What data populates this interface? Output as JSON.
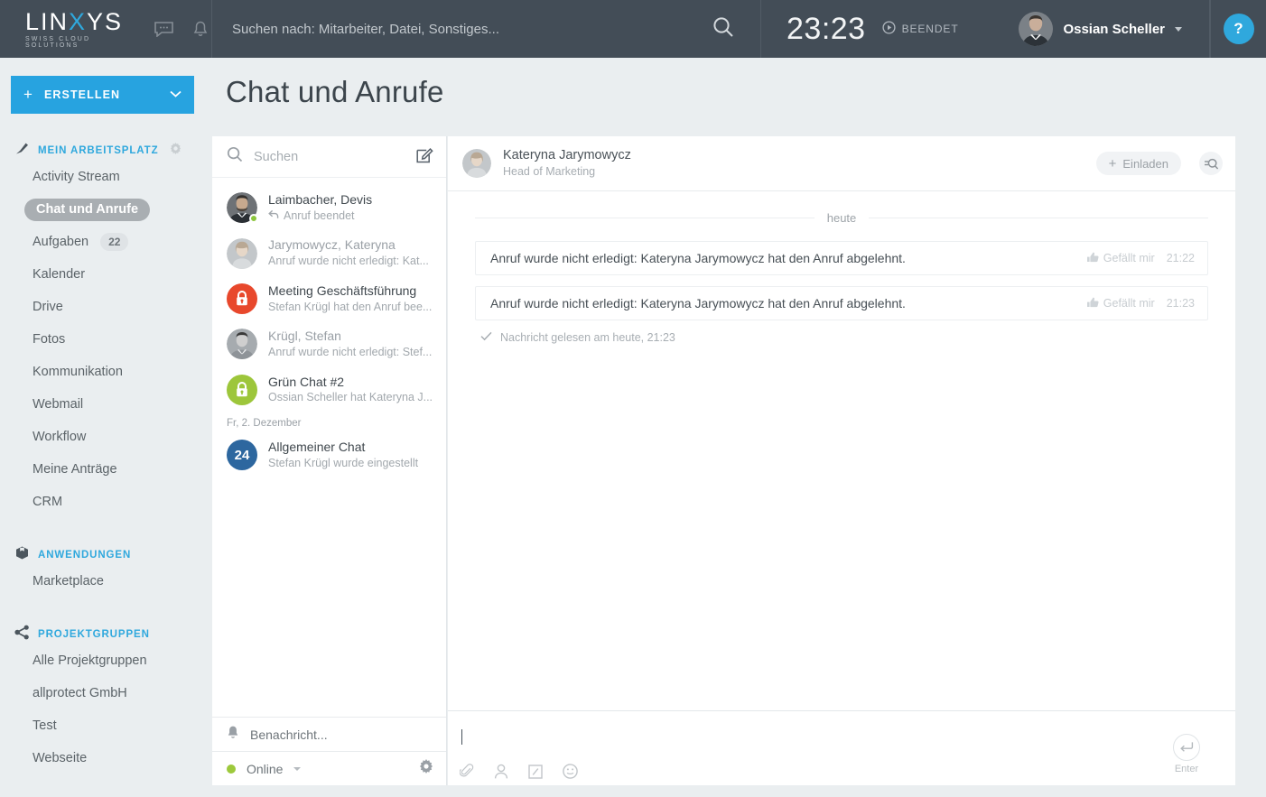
{
  "topbar": {
    "logo_main": "LIN",
    "logo_x": "X",
    "logo_main2": "YS",
    "logo_sub": "SWISS CLOUD SOLUTIONS",
    "chat_icon": "speech-bubble-icon",
    "bell_icon": "bell-icon",
    "search_placeholder": "Suchen nach: Mitarbeiter, Datei, Sonstiges...",
    "search_icon": "search-icon",
    "clock_time": "23:23",
    "clock_state": "BEENDET",
    "clock_state_icon": "play-circle-icon",
    "user_name": "Ossian Scheller",
    "user_caret": "chevron-down-icon",
    "help_label": "?"
  },
  "sidebar": {
    "create_label": "ERSTELLEN",
    "create_plus": "+",
    "sections": [
      {
        "title": "MEIN ARBEITSPLATZ",
        "icon": "pin-icon",
        "gear": true,
        "items": [
          {
            "label": "Activity Stream",
            "active": false,
            "badge": null
          },
          {
            "label": "Chat und Anrufe",
            "active": true,
            "badge": null
          },
          {
            "label": "Aufgaben",
            "active": false,
            "badge": "22"
          },
          {
            "label": "Kalender",
            "active": false,
            "badge": null
          },
          {
            "label": "Drive",
            "active": false,
            "badge": null
          },
          {
            "label": "Fotos",
            "active": false,
            "badge": null
          },
          {
            "label": "Kommunikation",
            "active": false,
            "badge": null
          },
          {
            "label": "Webmail",
            "active": false,
            "badge": null
          },
          {
            "label": "Workflow",
            "active": false,
            "badge": null
          },
          {
            "label": "Meine Anträge",
            "active": false,
            "badge": null
          },
          {
            "label": "CRM",
            "active": false,
            "badge": null
          }
        ]
      },
      {
        "title": "ANWENDUNGEN",
        "icon": "box-icon",
        "gear": false,
        "items": [
          {
            "label": "Marketplace",
            "active": false,
            "badge": null
          }
        ]
      },
      {
        "title": "PROJEKTGRUPPEN",
        "icon": "share-icon",
        "gear": false,
        "items": [
          {
            "label": "Alle Projektgruppen",
            "active": false,
            "badge": null
          },
          {
            "label": "allprotect GmbH",
            "active": false,
            "badge": null
          },
          {
            "label": "Test",
            "active": false,
            "badge": null
          },
          {
            "label": "Webseite",
            "active": false,
            "badge": null
          }
        ]
      }
    ]
  },
  "page": {
    "title": "Chat und Anrufe"
  },
  "chat_list": {
    "search_placeholder": "Suchen",
    "search_icon": "search-icon",
    "compose_icon": "compose-pencil-icon",
    "groups": [
      {
        "date_label": null,
        "rows": [
          {
            "name": "Laimbacher, Devis",
            "preview": "Anruf beendet",
            "preview_icon": "call-returned-arrow-icon",
            "avatar_type": "photo-male",
            "avatar_color": "#7b7f83",
            "online": true,
            "unread": true
          },
          {
            "name": "Jarymowycz, Kateryna",
            "preview": "Anruf wurde nicht erledigt: Kat...",
            "preview_icon": null,
            "avatar_type": "photo-female",
            "avatar_color": "#b7bcc0",
            "online": false,
            "unread": false
          },
          {
            "name": "Meeting Geschäftsführung",
            "preview": "Stefan Krügl hat den Anruf bee...",
            "preview_icon": null,
            "avatar_type": "lock",
            "avatar_color": "#e8482c",
            "online": false,
            "unread": true
          },
          {
            "name": "Krügl, Stefan",
            "preview": "Anruf wurde nicht erledigt: Stef...",
            "preview_icon": null,
            "avatar_type": "photo-male2",
            "avatar_color": "#9aa0a4",
            "online": false,
            "unread": false
          },
          {
            "name": "Grün Chat #2",
            "preview": "Ossian Scheller hat Kateryna J...",
            "preview_icon": null,
            "avatar_type": "lock",
            "avatar_color": "#9dc63b",
            "online": false,
            "unread": true
          }
        ]
      },
      {
        "date_label": "Fr, 2. Dezember",
        "rows": [
          {
            "name": "Allgemeiner Chat",
            "preview": "Stefan Krügl wurde eingestellt",
            "preview_icon": null,
            "avatar_type": "count",
            "avatar_color": "#2d679f",
            "avatar_text": "24",
            "online": false,
            "unread": true
          }
        ]
      }
    ],
    "footer": {
      "notify_label": "Benachricht...",
      "notify_icon": "bell-icon",
      "status_label": "Online",
      "status_caret": "chevron-down-icon",
      "settings_icon": "gear-icon"
    }
  },
  "conversation": {
    "header": {
      "name": "Kateryna Jarymowycz",
      "role": "Head of Marketing",
      "invite_label": "Einladen",
      "invite_plus": "+",
      "search_in_chat_icon": "filter-search-icon"
    },
    "day_separator": "heute",
    "messages": [
      {
        "text": "Anruf wurde nicht erledigt: Kateryna Jarymowycz hat den Anruf abgelehnt.",
        "like_label": "Gefällt mir",
        "like_icon": "thumbs-up-icon",
        "time": "21:22"
      },
      {
        "text": "Anruf wurde nicht erledigt: Kateryna Jarymowycz hat den Anruf abgelehnt.",
        "like_label": "Gefällt mir",
        "like_icon": "thumbs-up-icon",
        "time": "21:23"
      }
    ],
    "read_receipt": {
      "icon": "check-icon",
      "text": "Nachricht gelesen am heute, 21:23"
    },
    "composer": {
      "value": "",
      "tools": [
        {
          "icon": "paperclip-icon"
        },
        {
          "icon": "person-icon"
        },
        {
          "icon": "slash-command-icon"
        },
        {
          "icon": "smiley-icon"
        }
      ],
      "send_icon": "enter-arrow-icon",
      "send_label": "Enter"
    }
  },
  "colors": {
    "accent": "#2fa8dd",
    "topbar_bg": "#434d57",
    "page_bg": "#eaeef0",
    "online_green": "#8cc63e"
  }
}
